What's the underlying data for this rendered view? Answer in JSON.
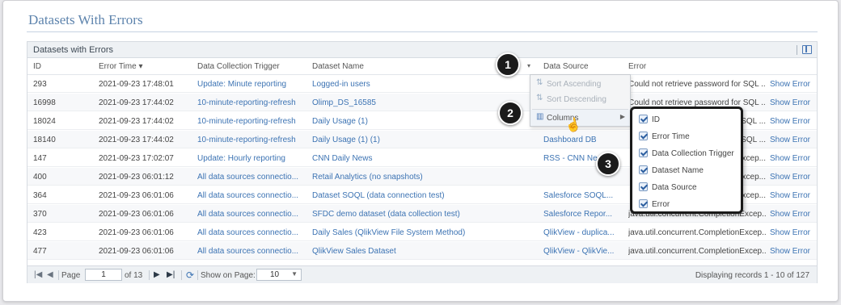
{
  "page_title": "Datasets With Errors",
  "panel": {
    "title": "Datasets with Errors",
    "columns": [
      "ID",
      "Error Time ▾",
      "Data Collection Trigger",
      "Dataset Name",
      "Data Source",
      "Error"
    ],
    "menu_trigger": "▾"
  },
  "rows": [
    {
      "id": "293",
      "time": "2021-09-23 17:48:01",
      "trigger": "Update: Minute reporting",
      "dataset": "Logged-in users",
      "source": "",
      "error": "Could not retrieve password for SQL ...",
      "action": "Show Error"
    },
    {
      "id": "16998",
      "time": "2021-09-23 17:44:02",
      "trigger": "10-minute-reporting-refresh",
      "dataset": "Olimp_DS_16585",
      "source": "",
      "error": "Could not retrieve password for SQL ...",
      "action": "Show Error"
    },
    {
      "id": "18024",
      "time": "2021-09-23 17:44:02",
      "trigger": "10-minute-reporting-refresh",
      "dataset": "Daily Usage (1)",
      "source": "Dashboard DB",
      "error": "SQL ...",
      "action": "Show Error"
    },
    {
      "id": "18140",
      "time": "2021-09-23 17:44:02",
      "trigger": "10-minute-reporting-refresh",
      "dataset": "Daily Usage (1) (1)",
      "source": "Dashboard DB",
      "error": "SQL ...",
      "action": "Show Error"
    },
    {
      "id": "147",
      "time": "2021-09-23 17:02:07",
      "trigger": "Update: Hourly reporting",
      "dataset": "CNN Daily News",
      "source": "RSS - CNN Ne",
      "error": "xcep...",
      "action": "Show Error"
    },
    {
      "id": "400",
      "time": "2021-09-23 06:01:12",
      "trigger": "All data sources connectio...",
      "dataset": "Retail Analytics (no snapshots)",
      "source": "",
      "error": "xcep...",
      "action": "Show Error"
    },
    {
      "id": "364",
      "time": "2021-09-23 06:01:06",
      "trigger": "All data sources connectio...",
      "dataset": "Dataset SOQL (data connection test)",
      "source": "Salesforce SOQL...",
      "error": "xcep...",
      "action": "Show Error"
    },
    {
      "id": "370",
      "time": "2021-09-23 06:01:06",
      "trigger": "All data sources connectio...",
      "dataset": "SFDC demo dataset (data collection test)",
      "source": "Salesforce Repor...",
      "error": "java.util.concurrent.CompletionExcep...",
      "action": "Show Error"
    },
    {
      "id": "423",
      "time": "2021-09-23 06:01:06",
      "trigger": "All data sources connectio...",
      "dataset": "Daily Sales (QlikView File System Method)",
      "source": "QlikView - duplica...",
      "error": "java.util.concurrent.CompletionExcep...",
      "action": "Show Error"
    },
    {
      "id": "477",
      "time": "2021-09-23 06:01:06",
      "trigger": "All data sources connectio...",
      "dataset": "QlikView Sales Dataset",
      "source": "QlikView - QlikVie...",
      "error": "java.util.concurrent.CompletionExcep...",
      "action": "Show Error"
    }
  ],
  "pager": {
    "page_label": "Page",
    "page_value": "1",
    "of_pages": "of 13",
    "show_label": "Show on Page:",
    "page_size": "10",
    "status": "Displaying records 1 - 10 of 127"
  },
  "context_menu": {
    "sort_asc": "Sort Ascending",
    "sort_desc": "Sort Descending",
    "columns": "Columns"
  },
  "columns_menu": [
    "ID",
    "Error Time",
    "Data Collection Trigger",
    "Dataset Name",
    "Data Source",
    "Error"
  ],
  "callouts": [
    "1",
    "2",
    "3"
  ],
  "colors": {
    "link": "#3c73b3",
    "title": "#5e84ad",
    "callout": "#1b1b1b"
  }
}
